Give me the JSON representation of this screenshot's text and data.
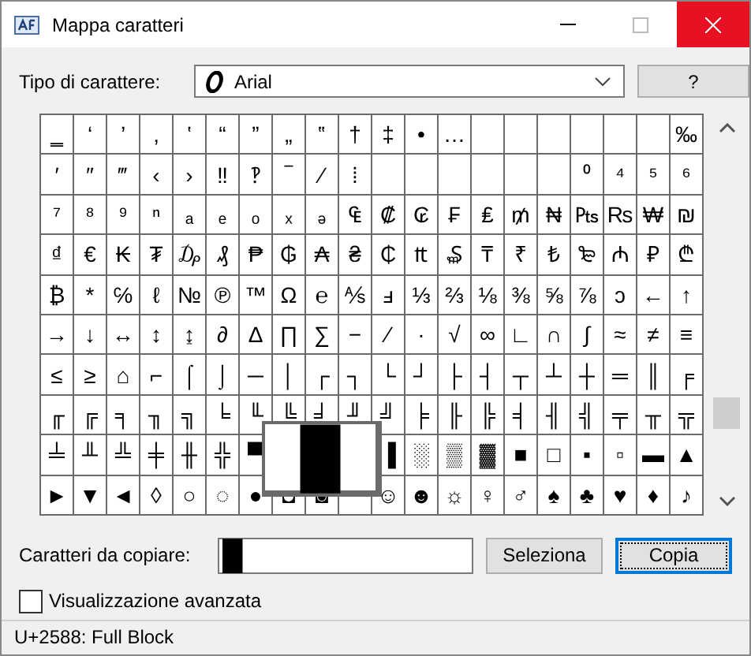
{
  "window": {
    "title": "Mappa caratteri"
  },
  "font_picker": {
    "label": "Tipo di carattere:",
    "value": "Arial"
  },
  "help_button": "?",
  "grid": {
    "rows": [
      [
        "‗",
        "‘",
        "’",
        "‚",
        "‛",
        "“",
        "”",
        "„",
        "‟",
        "†",
        "‡",
        "•",
        "…",
        null,
        null,
        null,
        null,
        null,
        null,
        "‰"
      ],
      [
        "′",
        "″",
        "‴",
        "‹",
        "›",
        "‼",
        "‽",
        "‾",
        "⁄",
        "⁞",
        null,
        null,
        null,
        null,
        null,
        null,
        "⁰",
        "⁴",
        "⁵",
        "⁶"
      ],
      [
        "⁷",
        "⁸",
        "⁹",
        "ⁿ",
        "ₐ",
        "ₑ",
        "ₒ",
        "ₓ",
        "ₔ",
        "₠",
        "₡",
        "₢",
        "₣",
        "₤",
        "₥",
        "₦",
        "₧",
        "₨",
        "₩",
        "₪"
      ],
      [
        "₫",
        "€",
        "₭",
        "₮",
        "₯",
        "₰",
        "₱",
        "₲",
        "₳",
        "₴",
        "₵",
        "₶",
        "₷",
        "₸",
        "₹",
        "₺",
        "₻",
        "₼",
        "₽",
        "₾"
      ],
      [
        "₿",
        "*",
        "℅",
        "ℓ",
        "№",
        "℗",
        "™",
        "Ω",
        "℮",
        "⅍",
        "ⅎ",
        "⅓",
        "⅔",
        "⅛",
        "⅜",
        "⅝",
        "⅞",
        "ↄ",
        "←",
        "↑"
      ],
      [
        "→",
        "↓",
        "↔",
        "↕",
        "↨",
        "∂",
        "∆",
        "∏",
        "∑",
        "−",
        "∕",
        "∙",
        "√",
        "∞",
        "∟",
        "∩",
        "∫",
        "≈",
        "≠",
        "≡"
      ],
      [
        "≤",
        "≥",
        "⌂",
        "⌐",
        "⌠",
        "⌡",
        "─",
        "│",
        "┌",
        "┐",
        "└",
        "┘",
        "├",
        "┤",
        "┬",
        "┴",
        "┼",
        "═",
        "║",
        "╒"
      ],
      [
        "╓",
        "╔",
        "╕",
        "╖",
        "╗",
        "╘",
        "╙",
        "╚",
        "╛",
        "╜",
        "╝",
        "╞",
        "╟",
        "╠",
        "╡",
        "╢",
        "╣",
        "╤",
        "╥",
        "╦"
      ],
      [
        "╧",
        "╨",
        "╩",
        "╪",
        "╫",
        "╬",
        "▀",
        null,
        null,
        null,
        "▐",
        "░",
        "▒",
        "▓",
        "■",
        "□",
        "▪",
        "▫",
        "▬",
        "▲"
      ],
      [
        "►",
        "▼",
        "◄",
        "◊",
        "○",
        "◌",
        "●",
        "◘",
        "◙",
        null,
        "☺",
        "☻",
        "☼",
        "♀",
        "♂",
        "♠",
        "♣",
        "♥",
        "♦",
        "♪"
      ]
    ],
    "magnified": "█"
  },
  "copy": {
    "label": "Caratteri da copiare:",
    "value": "█"
  },
  "buttons": [
    {
      "label": "Seleziona",
      "focused": false
    },
    {
      "label": "Copia",
      "focused": true
    }
  ],
  "advanced_view": {
    "label": "Visualizzazione avanzata",
    "checked": false
  },
  "status_bar": "U+2588: Full Block"
}
